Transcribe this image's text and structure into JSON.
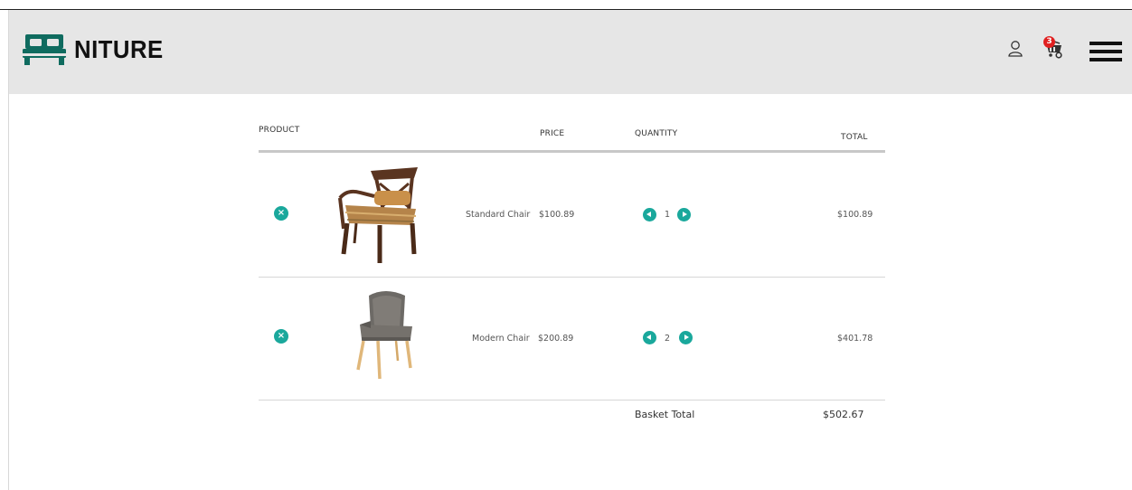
{
  "header": {
    "brand": "NITURE",
    "cart_count": "3",
    "icons": {
      "logo": "bed-icon",
      "account": "user-icon",
      "cart": "cart-icon",
      "menu": "hamburger-menu-icon"
    }
  },
  "table": {
    "headers": {
      "product": "PRODUCT",
      "price": "PRICE",
      "quantity": "QUANTITY",
      "total": "TOTAL"
    },
    "rows": [
      {
        "name": "Standard Chair",
        "price": "$100.89",
        "quantity": "1",
        "total": "$100.89",
        "image": "wooden-armchair-image"
      },
      {
        "name": "Modern Chair",
        "price": "$200.89",
        "quantity": "2",
        "total": "$401.78",
        "image": "grey-upholstered-chair-image"
      }
    ],
    "basket_total_label": "Basket Total",
    "basket_total_value": "$502.67"
  },
  "colors": {
    "accent": "#1aa89c",
    "header_bg": "#e6e6e6",
    "brand_icon": "#0f6b5f",
    "badge": "#e02020"
  }
}
